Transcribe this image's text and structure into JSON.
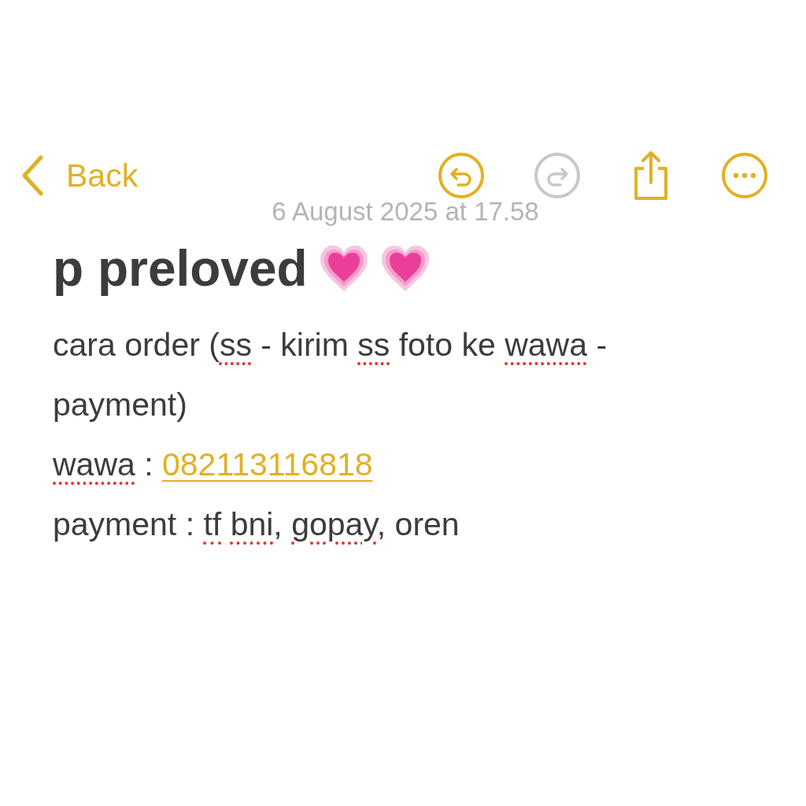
{
  "nav": {
    "back_label": "Back",
    "actions": [
      {
        "kind": "undo",
        "disabled": false
      },
      {
        "kind": "redo",
        "disabled": true
      },
      {
        "kind": "share",
        "disabled": false
      },
      {
        "kind": "more",
        "disabled": false
      }
    ]
  },
  "note": {
    "date": "6 August 2025 at 17.58",
    "title": "p preloved",
    "title_emojis": [
      {
        "kind": "heart"
      },
      {
        "kind": "heart"
      }
    ],
    "lines": [
      {
        "segments": [
          {
            "kind": "text",
            "text": "cara order (",
            "misspelled": false
          },
          {
            "kind": "text",
            "text": "ss",
            "misspelled": true
          },
          {
            "kind": "text",
            "text": " - kirim ",
            "misspelled": false
          },
          {
            "kind": "text",
            "text": "ss",
            "misspelled": true
          },
          {
            "kind": "text",
            "text": " foto ke ",
            "misspelled": false
          },
          {
            "kind": "text",
            "text": "wawa",
            "misspelled": true
          },
          {
            "kind": "text",
            "text": " - payment)",
            "misspelled": false
          }
        ]
      },
      {
        "segments": [
          {
            "kind": "text",
            "text": "wawa",
            "misspelled": true
          },
          {
            "kind": "text",
            "text": " : ",
            "misspelled": false
          },
          {
            "kind": "link",
            "text": "082113116818"
          }
        ]
      },
      {
        "segments": [
          {
            "kind": "text",
            "text": "payment : ",
            "misspelled": false
          },
          {
            "kind": "text",
            "text": "tf",
            "misspelled": true
          },
          {
            "kind": "text",
            "text": "bni",
            "misspelled": true,
            "space_before": true
          },
          {
            "kind": "text",
            "text": ", ",
            "misspelled": false
          },
          {
            "kind": "text",
            "text": "gopay",
            "misspelled": true
          },
          {
            "kind": "text",
            "text": ", oren",
            "misspelled": false
          }
        ]
      }
    ]
  }
}
